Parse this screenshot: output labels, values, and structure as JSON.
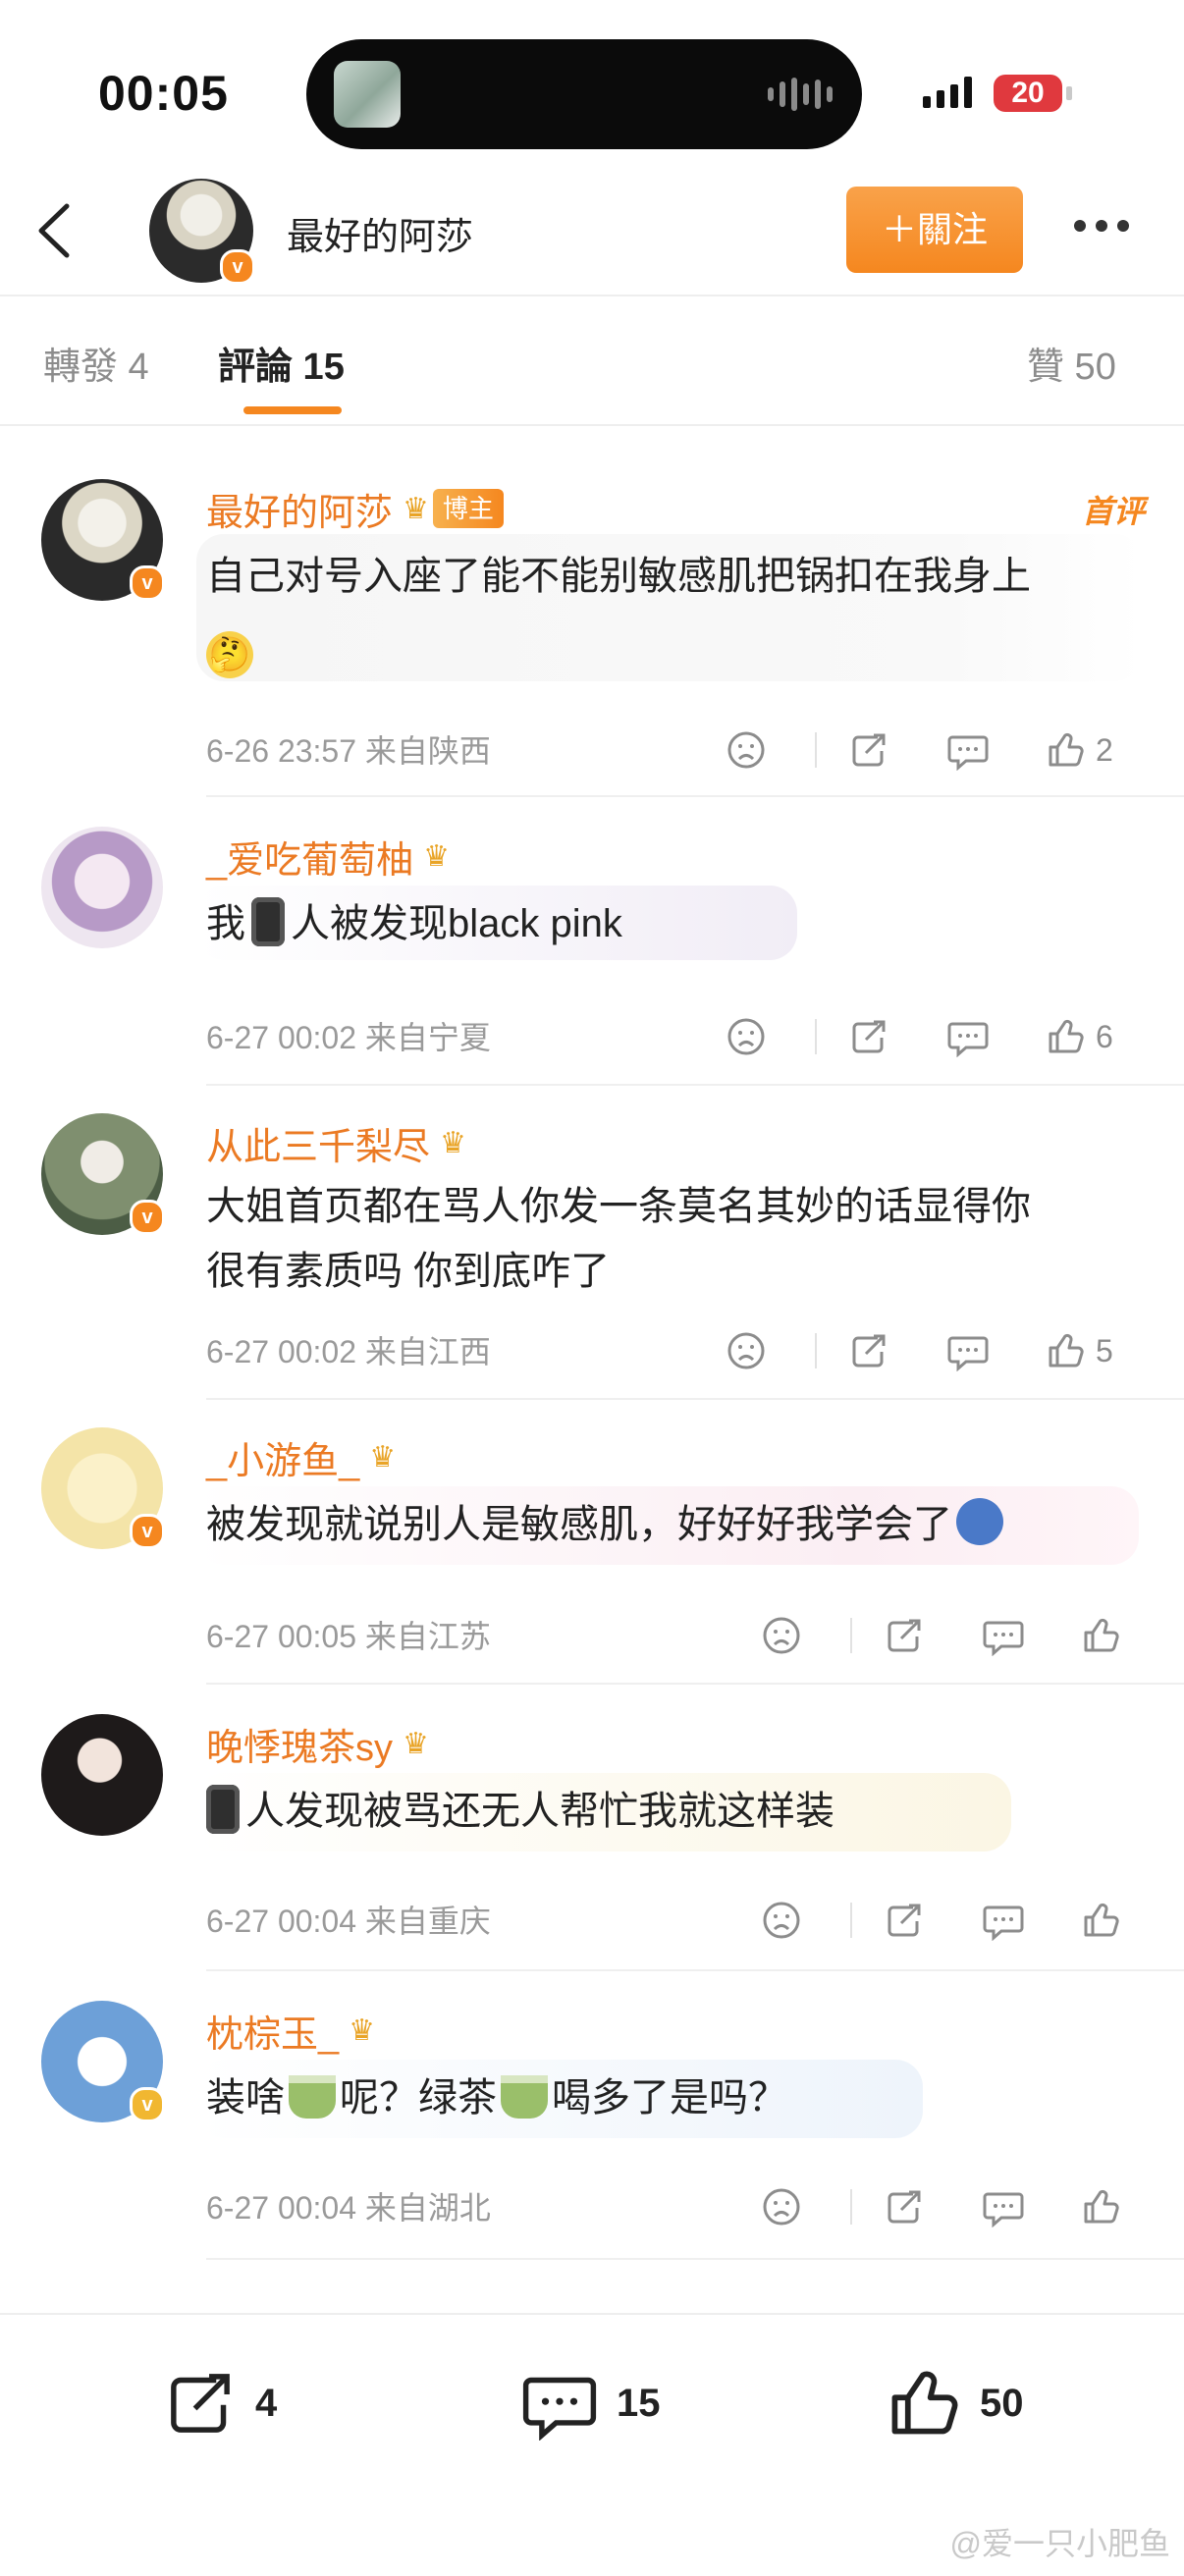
{
  "status_bar": {
    "time": "00:05",
    "battery": "20"
  },
  "header": {
    "back_icon": "chevron-left-icon",
    "name": "最好的阿莎",
    "follow_label": "＋關注",
    "more_icon": "more-dots-icon",
    "accent_color": "#f5871f"
  },
  "tabs": {
    "repost": "轉發 4",
    "comments": "評論 15",
    "likes": "贊 50"
  },
  "comments": [
    {
      "name": "最好的阿莎",
      "badge": "博主",
      "tag": "首评",
      "text_line1": "自己对号入座了能不能别敏感肌把锅扣在我身上",
      "emoji": "🤔",
      "date": "6-26 23:57",
      "location": "来自陕西",
      "likes": "2"
    },
    {
      "name": "_爱吃葡萄柚",
      "text_before": "我",
      "text_after": "人被发现black pink",
      "date": "6-27 00:02",
      "location": "来自宁夏",
      "likes": "6"
    },
    {
      "name": "从此三千梨尽",
      "text_line1": "大姐首页都在骂人你发一条莫名其妙的话显得你",
      "text_line2": "很有素质吗 你到底咋了",
      "date": "6-27 00:02",
      "location": "来自江西",
      "likes": "5"
    },
    {
      "name": "_小游鱼_",
      "text_line1": "被发现就说别人是敏感肌，好好好我学会了",
      "date": "6-27 00:05",
      "location": "来自江苏",
      "likes": ""
    },
    {
      "name": "晚悸瑰茶sy",
      "text_after": "人发现被骂还无人帮忙我就这样装",
      "date": "6-27 00:04",
      "location": "来自重庆",
      "likes": ""
    },
    {
      "name": "枕棕玉_",
      "text_a": "装啥",
      "text_b": "呢？绿茶",
      "text_c": "喝多了是吗？",
      "date": "6-27 00:04",
      "location": "来自湖北",
      "likes": ""
    }
  ],
  "bottom_bar": {
    "repost_count": "4",
    "comment_count": "15",
    "like_count": "50",
    "watermark": "@爱一只小肥鱼"
  }
}
